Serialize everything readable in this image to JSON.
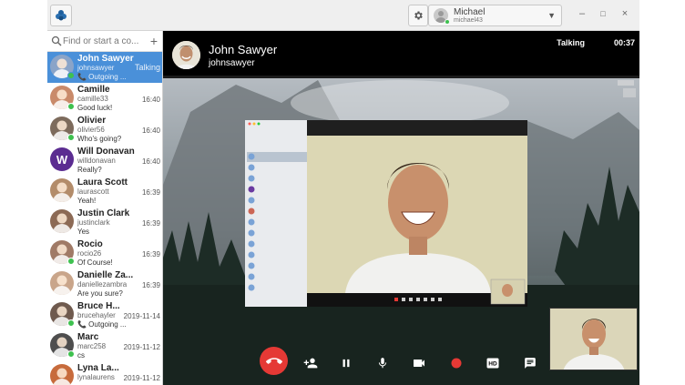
{
  "titlebar": {
    "account_name": "Michael",
    "account_id": "michael43",
    "minimize": "–",
    "maximize": "□",
    "close": "×"
  },
  "sidebar": {
    "search_placeholder": "Find or start a co...",
    "add_label": "+",
    "contacts": [
      {
        "name": "John Sawyer",
        "user": "johnsawyer",
        "last": "📞 Outgoing ...",
        "time": "Talking",
        "avatar_color": "#8aa4c8",
        "online": true,
        "active": true
      },
      {
        "name": "Camille",
        "user": "camille33",
        "last": "Good luck!",
        "time": "16:40",
        "avatar_color": "#c98a6a",
        "online": true,
        "active": false
      },
      {
        "name": "Olivier",
        "user": "olivier56",
        "last": "Who's going?",
        "time": "16:40",
        "avatar_color": "#7d6b5c",
        "online": true,
        "active": false
      },
      {
        "name": "Will Donavan",
        "user": "willdonavan",
        "last": "Really?",
        "time": "16:40",
        "avatar_color": "#5b2c91",
        "initial": "W",
        "online": false,
        "active": false
      },
      {
        "name": "Laura Scott",
        "user": "laurascott",
        "last": "Yeah!",
        "time": "16:39",
        "avatar_color": "#b38c6a",
        "online": false,
        "active": false
      },
      {
        "name": "Justin Clark",
        "user": "justinclark",
        "last": "Yes",
        "time": "16:39",
        "avatar_color": "#8c6a55",
        "online": false,
        "active": false
      },
      {
        "name": "Rocio",
        "user": "rocio26",
        "last": "Of Course!",
        "time": "16:39",
        "avatar_color": "#a07a66",
        "online": true,
        "active": false
      },
      {
        "name": "Danielle Za...",
        "user": "daniellezambra",
        "last": "Are you sure?",
        "time": "16:39",
        "avatar_color": "#c9a58a",
        "online": false,
        "active": false
      },
      {
        "name": "Bruce H...",
        "user": "brucehayler",
        "last": "📞 Outgoing ...",
        "time": "2019-11-14",
        "avatar_color": "#6f5a4e",
        "online": true,
        "active": false
      },
      {
        "name": "Marc",
        "user": "marc258",
        "last": "cs",
        "time": "2019-11-12",
        "avatar_color": "#4e4e4e",
        "online": true,
        "active": false
      },
      {
        "name": "Lyna La...",
        "user": "lynalaurens",
        "last": "",
        "time": "2019-11-12",
        "avatar_color": "#c76b3c",
        "online": false,
        "active": false
      }
    ]
  },
  "call": {
    "peer_name": "John Sawyer",
    "peer_id": "johnsawyer",
    "status": "Talking",
    "timer": "00:37"
  },
  "colors": {
    "accent": "#4a90d9",
    "online": "#3ec14f",
    "hangup": "#e53935",
    "record": "#e53935"
  },
  "icons": {
    "logo": "jami-logo-icon",
    "settings": "gear-icon",
    "hangup": "hangup-icon",
    "add_participant": "add-person-icon",
    "pause": "pause-icon",
    "mic": "microphone-icon",
    "video": "camera-icon",
    "record": "record-icon",
    "hd": "hd-icon",
    "chat": "chat-icon"
  }
}
